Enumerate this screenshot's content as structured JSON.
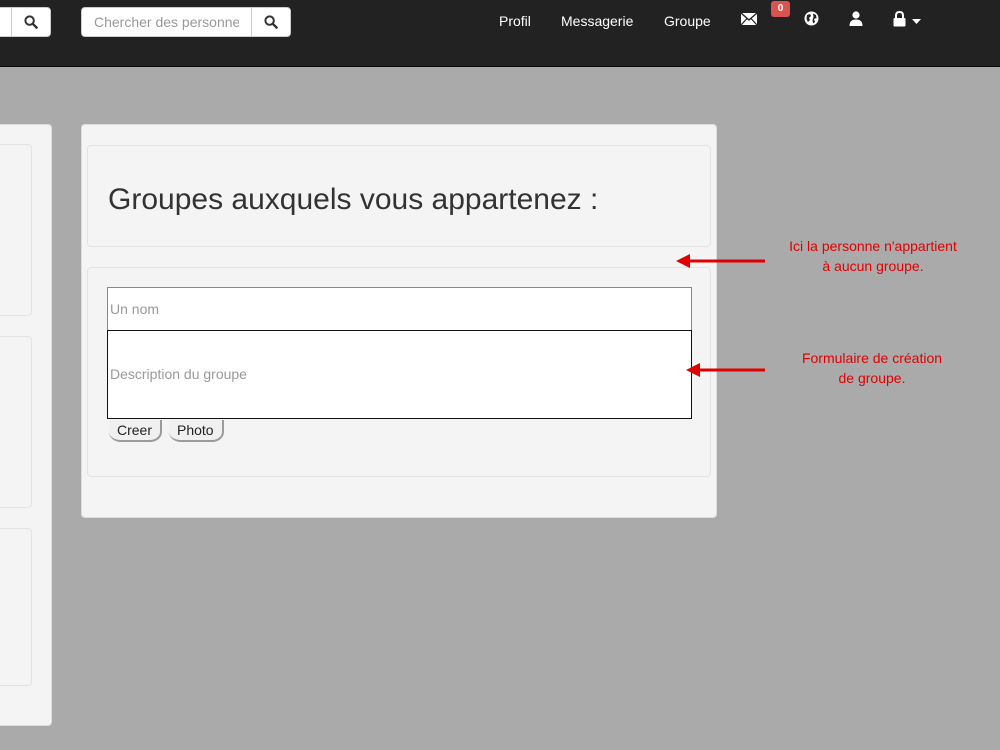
{
  "navbar": {
    "search_left": {
      "placeholder": ""
    },
    "search_people": {
      "placeholder": "Chercher des personnes"
    },
    "links": [
      {
        "label": "Profil"
      },
      {
        "label": "Messagerie"
      },
      {
        "label": "Groupe"
      }
    ],
    "icons": [
      "envelope-icon",
      "globe-icon",
      "user-icon",
      "lock-icon",
      "caret-down-icon"
    ],
    "messages_badge": "0"
  },
  "main": {
    "title": "Groupes auxquels vous appartenez :",
    "form": {
      "name_placeholder": "Un nom",
      "description_placeholder": "Description du groupe",
      "create_label": "Creer",
      "photo_label": "Photo"
    }
  },
  "annotations": {
    "no_group": "Ici la personne n'appartient\nà aucun groupe.",
    "create_form": "Formulaire de création\nde groupe."
  },
  "colors": {
    "navbar": "#222222",
    "background": "#aaaaaa",
    "panel": "#f4f4f4",
    "badge": "#d9534f",
    "annotation": "#e00000"
  }
}
